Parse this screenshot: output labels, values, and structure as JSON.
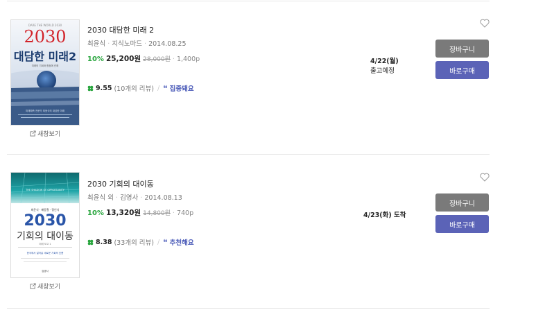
{
  "items": [
    {
      "title": "2030 대담한 미래 2",
      "author": "최윤식",
      "publisher": "지식노마드",
      "date": "2014.08.25",
      "discount": "10%",
      "price": "25,200원",
      "original_price": "28,000원",
      "pages": "1,400p",
      "score": "9.55",
      "reviews": "(10개의 리뷰)",
      "review_tag": "집중돼요",
      "delivery_date": "4/22(월)",
      "delivery_status": "출고예정",
      "new_window": "새창보기",
      "cart": "장바구니",
      "buy": "바로구매",
      "cover": {
        "top": "DARE THE WORLD 2030",
        "number": "2030",
        "title": "대담한 미래2",
        "sub": "미래의 기회와 함정에 관해",
        "body": "미래예측 전문가 최윤식의 대담한 미래"
      }
    },
    {
      "title": "2030 기회의 대이동",
      "author": "최윤식 외",
      "publisher": "김영사",
      "date": "2014.08.13",
      "discount": "10%",
      "price": "13,320원",
      "original_price": "14,800원",
      "pages": "740p",
      "score": "8.38",
      "reviews": "(33개의 리뷰)",
      "review_tag": "추천해요",
      "delivery_date": "4/23(화) 도착",
      "delivery_status": "",
      "new_window": "새창보기",
      "cart": "장바구니",
      "buy": "바로구매",
      "cover": {
        "top": "THE SHADOW OF OPPORTUNITY",
        "authors": "최윤식 · 배동철 · 정인식",
        "number": "2030",
        "title": "기회의 대이동",
        "sub": "미래 보고 1",
        "body": "한국에서 일어날 새로운 기회의 흐름",
        "pub": "김영사"
      }
    }
  ],
  "colors": {
    "green": "#2aa63f",
    "blue": "#5b63b7",
    "gray_btn": "#7a7a7a"
  }
}
